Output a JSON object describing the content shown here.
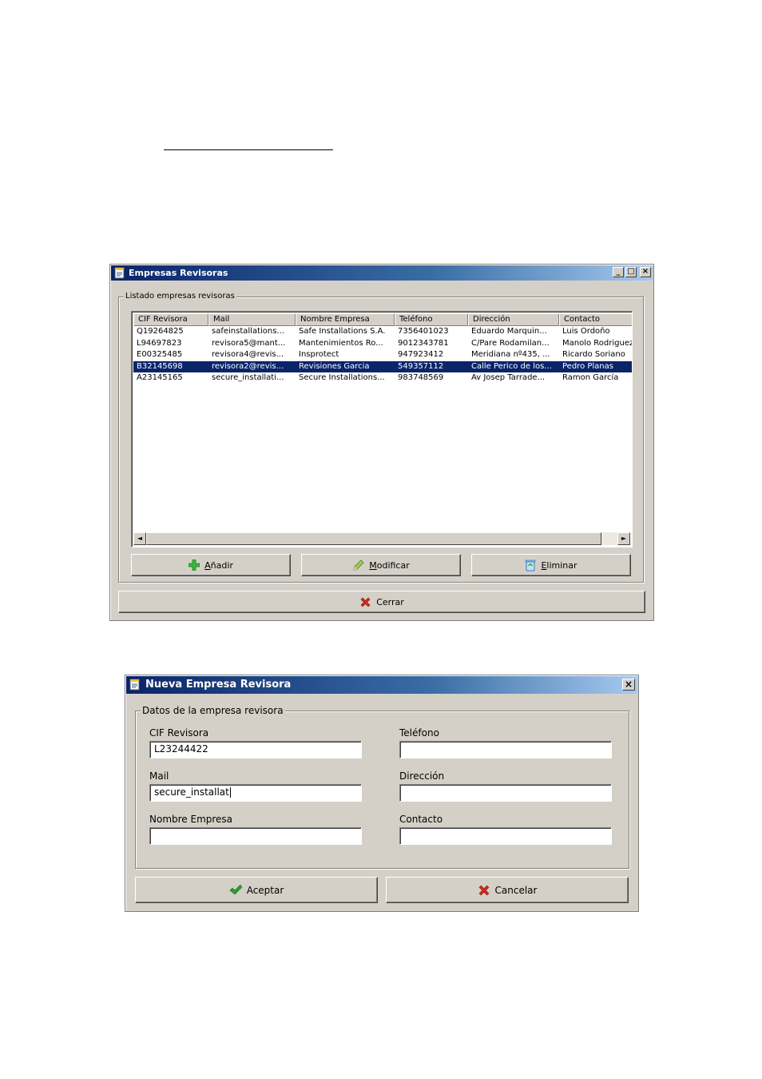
{
  "list_window": {
    "title": "Empresas Revisoras",
    "group_label": "Listado empresas revisoras",
    "columns": [
      "CIF Revisora",
      "Mail",
      "Nombre Empresa",
      "Teléfono",
      "Dirección",
      "Contacto"
    ],
    "rows": [
      [
        "Q19264825",
        "safeinstallations...",
        "Safe Installations S.A.",
        "7356401023",
        "Eduardo Marquin...",
        "Luis Ordoño"
      ],
      [
        "L94697823",
        "revisora5@mant...",
        "Mantenimientos Ro...",
        "9012343781",
        "C/Pare Rodamilan...",
        "Manolo Rodriguez"
      ],
      [
        "E00325485",
        "revisora4@revis...",
        "Insprotect",
        "947923412",
        "Meridiana nº435, ...",
        "Ricardo Soriano"
      ],
      [
        "B32145698",
        "revisora2@revis...",
        "Revisiones Garcia",
        "549357112",
        "Calle Perico de los...",
        "Pedro Planas"
      ],
      [
        "A23145165",
        "secure_installati...",
        "Secure Installations...",
        "983748569",
        "Av Josep Tarrade...",
        "Ramon García"
      ]
    ],
    "selected_row": 3,
    "buttons": {
      "add": {
        "mnemonic": "A",
        "rest": "ñadir"
      },
      "edit": {
        "mnemonic": "M",
        "rest": "odificar"
      },
      "delete": {
        "mnemonic": "E",
        "rest": "liminar"
      },
      "close": "Cerrar"
    },
    "scroll_left_glyph": "◄",
    "scroll_right_glyph": "►",
    "minimize_glyph": "_",
    "maximize_glyph": "□",
    "close_glyph": "×"
  },
  "form_window": {
    "title": "Nueva Empresa Revisora",
    "group_label": "Datos de la empresa revisora",
    "fields": {
      "cif": {
        "label": "CIF Revisora",
        "value": "L23244422"
      },
      "mail": {
        "label": "Mail",
        "value": "secure_installat"
      },
      "nombre": {
        "label": "Nombre Empresa",
        "value": ""
      },
      "telefono": {
        "label": "Teléfono",
        "value": ""
      },
      "direccion": {
        "label": "Dirección",
        "value": ""
      },
      "contacto": {
        "label": "Contacto",
        "value": ""
      }
    },
    "buttons": {
      "accept": "Aceptar",
      "cancel": "Cancelar"
    },
    "close_glyph": "×"
  },
  "colors": {
    "window_face": "#d4d0c8",
    "selection": "#0a246a",
    "titlebar_start": "#0a246a",
    "titlebar_end": "#a6caf0",
    "add_icon": "#3cb63c",
    "delete_icon": "#d22a1e",
    "accept_icon": "#2e9e2e"
  },
  "icons": {
    "app": "notepad-icon",
    "add": "plus-icon",
    "edit": "pencil-icon",
    "delete": "recycle-bin-icon",
    "close_action": "red-x-icon",
    "accept": "checkmark-icon"
  }
}
